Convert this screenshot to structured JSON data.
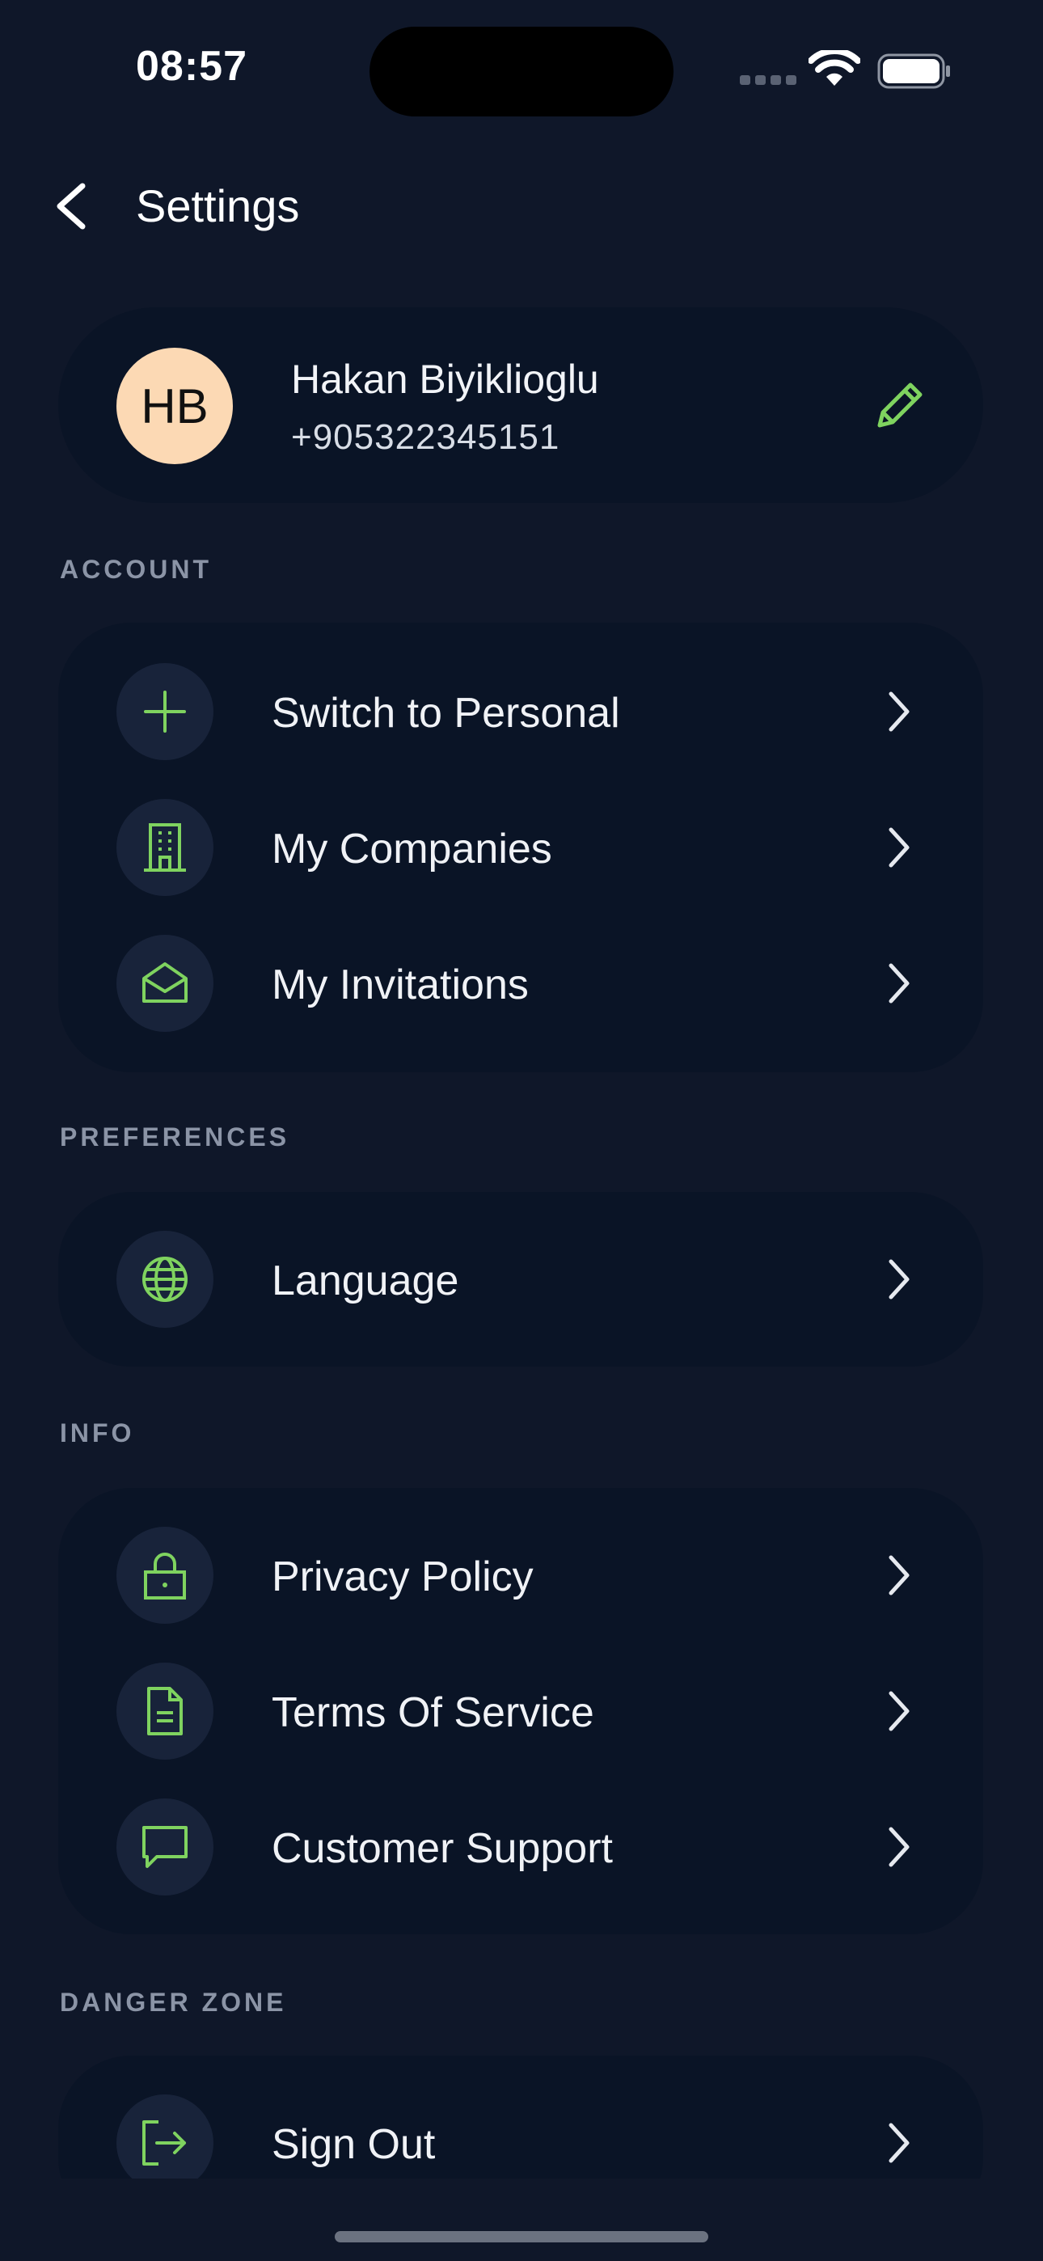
{
  "status_bar": {
    "time": "08:57",
    "icons": [
      "cellular-signal-icon",
      "wifi-icon",
      "battery-icon"
    ]
  },
  "header": {
    "title": "Settings",
    "back_icon": "chevron-left-icon"
  },
  "profile": {
    "initials": "HB",
    "name": "Hakan Biyiklioglu",
    "phone": "+905322345151",
    "avatar_color": "#fcd9b4",
    "edit_icon": "pencil-icon"
  },
  "sections": {
    "account": {
      "label": "ACCOUNT",
      "items": [
        {
          "label": "Switch to Personal",
          "icon": "plus-icon"
        },
        {
          "label": "My Companies",
          "icon": "building-icon"
        },
        {
          "label": "My Invitations",
          "icon": "envelope-open-icon"
        }
      ]
    },
    "preferences": {
      "label": "PREFERENCES",
      "items": [
        {
          "label": "Language",
          "icon": "globe-icon"
        }
      ]
    },
    "info": {
      "label": "INFO",
      "items": [
        {
          "label": "Privacy Policy",
          "icon": "lock-icon"
        },
        {
          "label": "Terms Of Service",
          "icon": "document-icon"
        },
        {
          "label": "Customer Support",
          "icon": "chat-bubble-icon"
        }
      ]
    },
    "danger_zone": {
      "label": "DANGER ZONE",
      "items": [
        {
          "label": "Sign Out",
          "icon": "sign-out-icon"
        }
      ]
    }
  },
  "colors": {
    "background": "#0f1729",
    "card": "#0a1426",
    "icon_circle": "#18233a",
    "accent_green": "#7fd35f",
    "section_label": "#8b94a6"
  }
}
